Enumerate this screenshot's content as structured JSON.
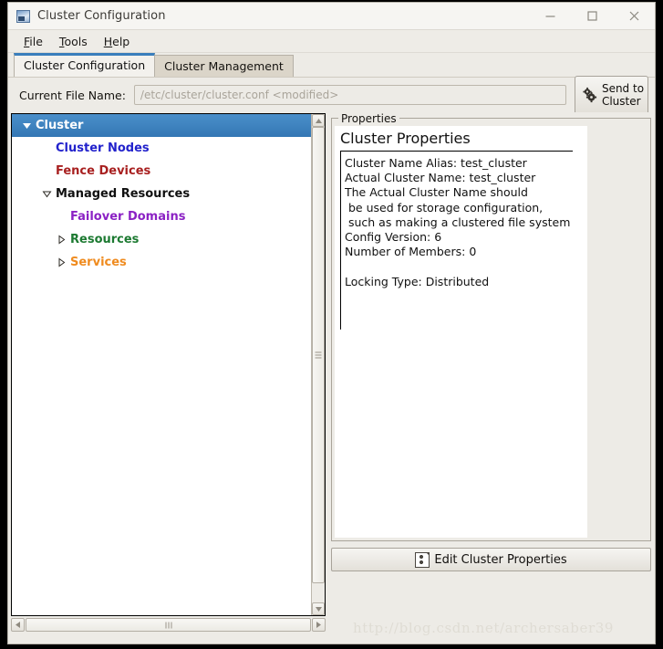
{
  "window": {
    "title": "Cluster Configuration",
    "icon": "app-icon",
    "minimize_label": "–",
    "maximize_label": "□",
    "close_label": "✕"
  },
  "menubar": {
    "items": [
      {
        "label": "File",
        "mnemonic": "F"
      },
      {
        "label": "Tools",
        "mnemonic": "T"
      },
      {
        "label": "Help",
        "mnemonic": "H"
      }
    ]
  },
  "tabs": [
    {
      "label": "Cluster Configuration",
      "active": true
    },
    {
      "label": "Cluster Management",
      "active": false
    }
  ],
  "filebar": {
    "label": "Current File Name:",
    "value": "/etc/cluster/cluster.conf  <modified>",
    "placeholder": "/etc/cluster/cluster.conf  <modified>",
    "send_button": {
      "line1": "Send to",
      "line2": "Cluster",
      "icon": "gears-icon"
    }
  },
  "tree": {
    "items": [
      {
        "label": "Cluster",
        "indent": 0,
        "twisty": "expanded-filled",
        "color": "#ffffff",
        "selected": true
      },
      {
        "label": "Cluster Nodes",
        "indent": 1,
        "twisty": "none",
        "color": "#2222cc",
        "selected": false
      },
      {
        "label": "Fence Devices",
        "indent": 1,
        "twisty": "none",
        "color": "#a82020",
        "selected": false
      },
      {
        "label": "Managed Resources",
        "indent": 1,
        "twisty": "expanded",
        "color": "#101010",
        "selected": false
      },
      {
        "label": "Failover Domains",
        "indent": 2,
        "twisty": "none",
        "color": "#8b21c4",
        "selected": false
      },
      {
        "label": "Resources",
        "indent": 2,
        "twisty": "collapsed",
        "color": "#1d7a32",
        "selected": false
      },
      {
        "label": "Services",
        "indent": 2,
        "twisty": "collapsed",
        "color": "#ef8b1f",
        "selected": false
      }
    ]
  },
  "scrollbars": {
    "vertical": {
      "up_arrow": "▲",
      "down_arrow": "▼",
      "grip": "grip-icon"
    },
    "horizontal": {
      "left_arrow": "◀",
      "right_arrow": "▶",
      "grip": "grip-icon"
    }
  },
  "properties": {
    "group_title": "Properties",
    "heading": "Cluster Properties",
    "body": "Cluster Name Alias: test_cluster\nActual Cluster Name: test_cluster\nThe Actual Cluster Name should\n be used for storage configuration,\n such as making a clustered file system\nConfig Version: 6\nNumber of Members: 0\n\nLocking Type: Distributed",
    "edit_button": {
      "label": "Edit Cluster Properties",
      "icon": "document-icon"
    }
  },
  "watermark": "http://blog.csdn.net/archersaber39",
  "colors": {
    "accent": "#3f86c4",
    "window_bg": "#edebe6",
    "tab_active_border": "#3a7ebc",
    "selection_bg": "#3f86c4"
  }
}
